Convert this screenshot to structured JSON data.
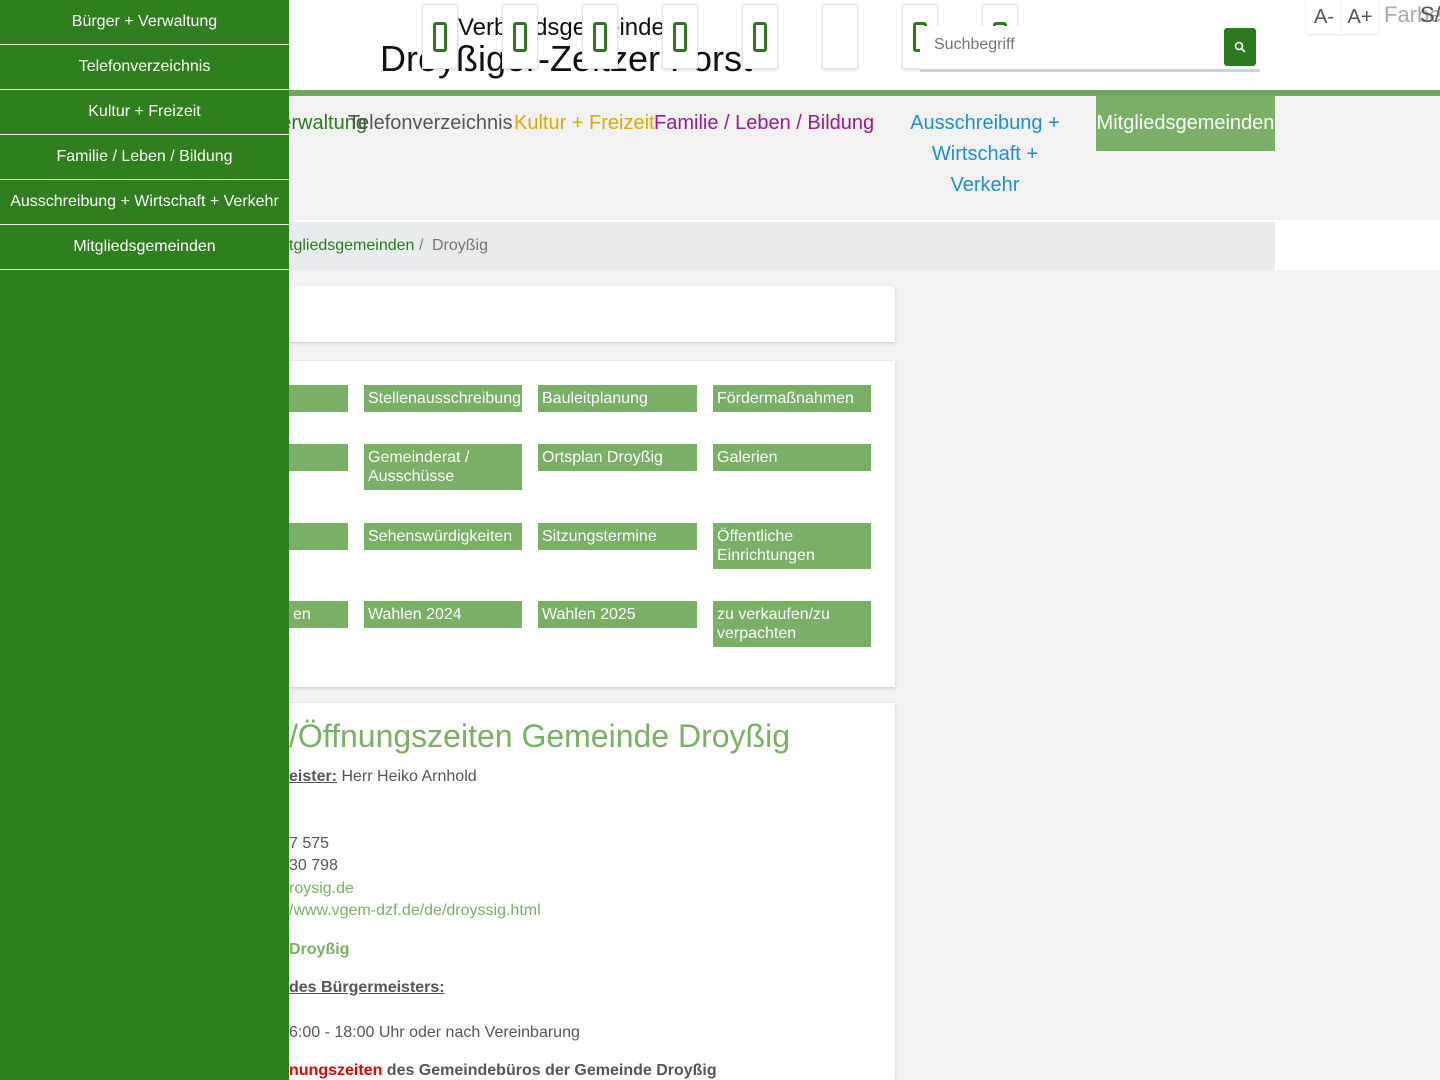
{
  "header": {
    "brand_line1": "Verbandsgemeinde",
    "brand_line2": "Droyßiger-Zeitzer Forst",
    "icons": [
      "icon-1",
      "icon-2",
      "icon-3",
      "icon-4",
      "icon-5",
      "icon-6",
      "icon-7",
      "icon-8"
    ],
    "search_placeholder": "Suchbegriff",
    "search_icon": "search-icon",
    "a11y": {
      "font_smaller": "A-",
      "font_larger": "A+",
      "color_label": "Farbe",
      "s_label": "S/"
    }
  },
  "nav": {
    "items": [
      {
        "label": "Bürger + Verwaltung",
        "color": "#2d7a1e"
      },
      {
        "label": "Telefonverzeichnis",
        "color": "#555555"
      },
      {
        "label": "Kultur + Freizeit",
        "color": "#e0a800"
      },
      {
        "label": "Familie / Leben / Bildung",
        "color": "#9b1b8c"
      },
      {
        "label": "Ausschreibung + Wirtschaft + Verkehr",
        "color": "#1e8fd0"
      },
      {
        "label": "Mitgliedsgemeinden",
        "color": "#ffffff"
      }
    ],
    "visible": {
      "item0": "Verwaltung",
      "item4_line1": "Ausschreibung +",
      "item4_line2": "Wirtschaft + Verkehr"
    }
  },
  "breadcrumb": {
    "link": "Mitgliedsgemeinden",
    "sep": "/",
    "current": "Droyßig",
    "visible_link": "tgliedsgemeinden"
  },
  "tiles": [
    {
      "label": "",
      "row": 0,
      "col": 0
    },
    {
      "label": "Stellenausschreibung",
      "row": 0,
      "col": 1
    },
    {
      "label": "Bauleitplanung",
      "row": 0,
      "col": 2
    },
    {
      "label": "Fördermaßnahmen",
      "row": 0,
      "col": 3
    },
    {
      "label": "",
      "row": 1,
      "col": 0
    },
    {
      "label": "Gemeinderat / Ausschüsse",
      "row": 1,
      "col": 1
    },
    {
      "label": "Ortsplan Droyßig",
      "row": 1,
      "col": 2
    },
    {
      "label": "Galerien",
      "row": 1,
      "col": 3
    },
    {
      "label": "",
      "row": 2,
      "col": 0
    },
    {
      "label": "Sehenswürdigkeiten",
      "row": 2,
      "col": 1
    },
    {
      "label": "Sitzungstermine",
      "row": 2,
      "col": 2
    },
    {
      "label": "Öffentliche Einrichtungen",
      "row": 2,
      "col": 3
    },
    {
      "label": "en",
      "row": 3,
      "col": 0
    },
    {
      "label": "Wahlen 2024",
      "row": 3,
      "col": 1
    },
    {
      "label": "Wahlen 2025",
      "row": 3,
      "col": 2
    },
    {
      "label": "zu verkaufen/zu verpachten",
      "row": 3,
      "col": 3
    }
  ],
  "content": {
    "title": "/Öffnungszeiten Gemeinde Droyßig",
    "mayor_label": "eister:",
    "mayor_name": " Herr Heiko Arnhold",
    "phone": "7 575",
    "fax": "30 798",
    "email": "roysig.de",
    "website": "/www.vgem-dzf.de/de/droyssig.html",
    "place": "Droyßig",
    "office_hours_label": "des Bürgermeisters:",
    "office_hours": "6:00 - 18:00 Uhr oder nach Vereinbarung",
    "opening_red": "nungszeiten",
    "opening_rest": " des Gemeindebüros der Gemeinde Droyßig"
  },
  "sidebar": {
    "items": [
      "Bürger + Verwaltung",
      "Telefonverzeichnis",
      "Kultur + Freizeit",
      "Familie / Leben / Bildung",
      "Ausschreibung + Wirtschaft + Verkehr",
      "Mitgliedsgemeinden"
    ],
    "bg_color": "#2f7f1f"
  }
}
